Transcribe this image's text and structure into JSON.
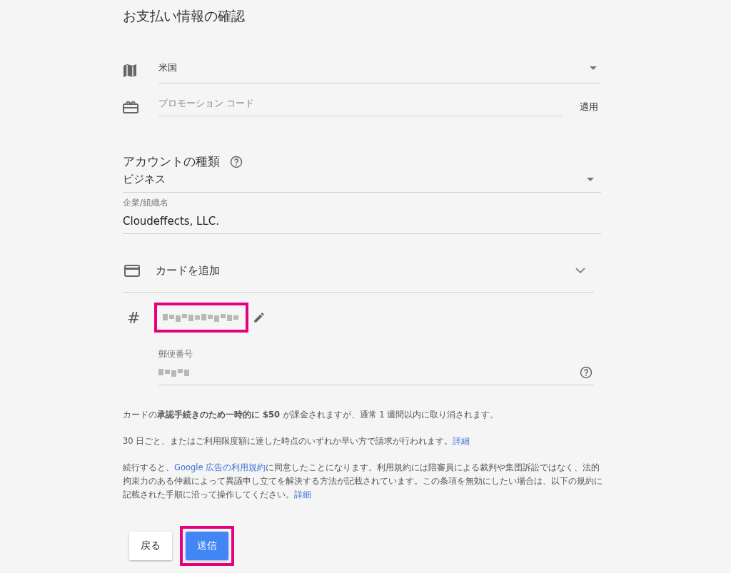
{
  "title": "お支払い情報の確認",
  "country": {
    "value": "米国"
  },
  "promo": {
    "placeholder": "プロモーション コード",
    "apply": "適用"
  },
  "account_type": {
    "heading": "アカウントの種類",
    "value": "ビジネス"
  },
  "organization": {
    "label": "企業/組織名",
    "value": "Cloudeffects, LLC."
  },
  "card": {
    "label": "カードを追加",
    "expanded": false,
    "number_symbol": "#",
    "highlighted": true
  },
  "postal": {
    "label": "郵便番号"
  },
  "paragraphs": [
    {
      "segments": [
        {
          "kind": "text",
          "text": "カードの**承認手続きのため一時的に $50** が課金されますが、通常 1 週間以内に取り消されます。"
        }
      ]
    },
    {
      "segments": [
        {
          "kind": "text",
          "text": "30 日ごと、またはご利用限度額に達した時点のいずれか早い方で請求が行われます。"
        },
        {
          "kind": "link",
          "text": "詳細"
        }
      ]
    },
    {
      "segments": [
        {
          "kind": "text",
          "text": "続行すると、"
        },
        {
          "kind": "link",
          "text": "Google 広告の利用規約"
        },
        {
          "kind": "text",
          "text": "に同意したことになります。利用規約には陪審員による裁判や集団訴訟ではなく、法的拘束力のある仲裁によって異議申し立てを解決する方法が記載されています。この条項を無効にしたい場合は、以下の規約に記載された手順に沿って操作してください。"
        },
        {
          "kind": "link",
          "text": "詳細"
        }
      ]
    }
  ],
  "buttons": [
    {
      "label": "戻る",
      "kind": "secondary",
      "highlighted": false
    },
    {
      "label": "送信",
      "kind": "primary",
      "highlighted": true
    }
  ]
}
